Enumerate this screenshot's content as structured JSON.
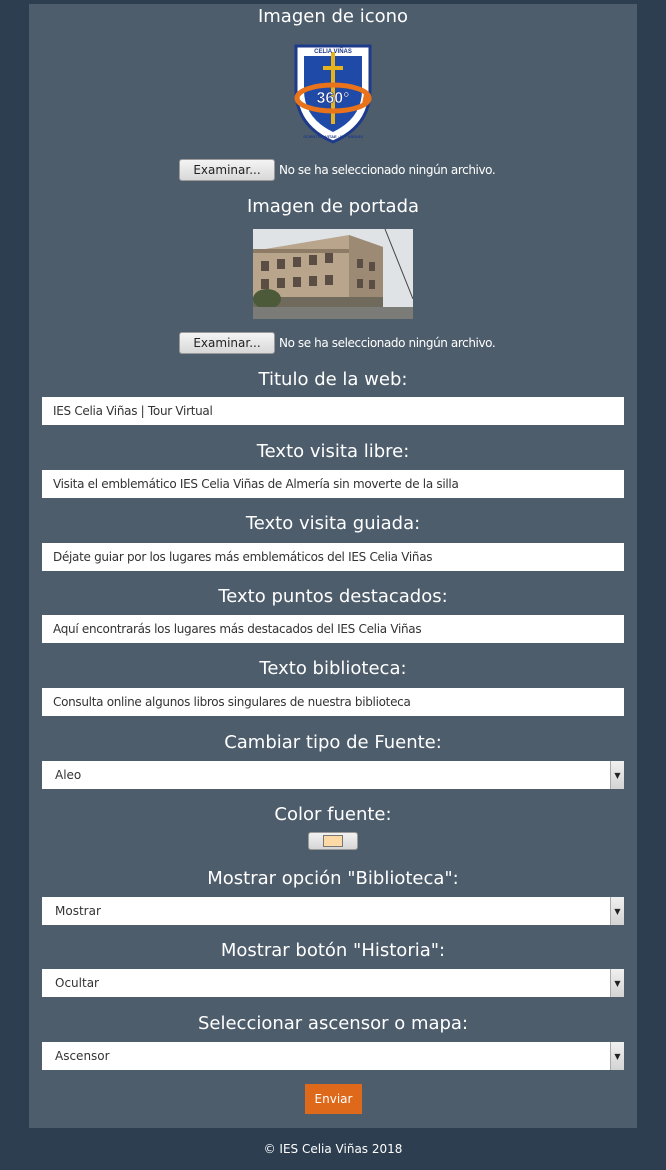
{
  "icon_section": {
    "title": "Imagen de icono",
    "logo": {
      "top_text": "CELIA VIÑAS",
      "badge_text": "360°",
      "bottom_text": "SCIENTIA · VITAE · IN · ARDUIS"
    },
    "browse_label": "Examinar...",
    "file_status": "No se ha seleccionado ningún archivo."
  },
  "cover_section": {
    "title": "Imagen de portada",
    "browse_label": "Examinar...",
    "file_status": "No se ha seleccionado ningún archivo."
  },
  "fields": {
    "web_title": {
      "label": "Titulo de la web:",
      "value": "IES Celia Viñas | Tour Virtual"
    },
    "free_visit": {
      "label": "Texto visita libre:",
      "value": "Visita el emblemático IES Celia Viñas de Almería sin moverte de la silla"
    },
    "guided_visit": {
      "label": "Texto visita guiada:",
      "value": "Déjate guiar por los lugares más emblemáticos del IES Celia Viñas"
    },
    "highlights": {
      "label": "Texto puntos destacados:",
      "value": "Aquí encontrarás los lugares más destacados del IES Celia Viñas"
    },
    "library": {
      "label": "Texto biblioteca:",
      "value": "Consulta online algunos libros singulares de nuestra biblioteca"
    }
  },
  "selects": {
    "font_type": {
      "label": "Cambiar tipo de Fuente:",
      "value": "Aleo"
    },
    "show_library": {
      "label": "Mostrar opción \"Biblioteca\":",
      "value": "Mostrar"
    },
    "show_history": {
      "label": "Mostrar botón \"Historia\":",
      "value": "Ocultar"
    },
    "elevator_map": {
      "label": "Seleccionar ascensor o mapa:",
      "value": "Ascensor"
    }
  },
  "font_color": {
    "label": "Color fuente:",
    "value": "#fdd9a5"
  },
  "submit_label": "Enviar",
  "footer": "© IES Celia Viñas 2018",
  "colors": {
    "page_bg": "#2c3e50",
    "panel_bg": "#4e5d6c",
    "accent": "#df691a"
  }
}
